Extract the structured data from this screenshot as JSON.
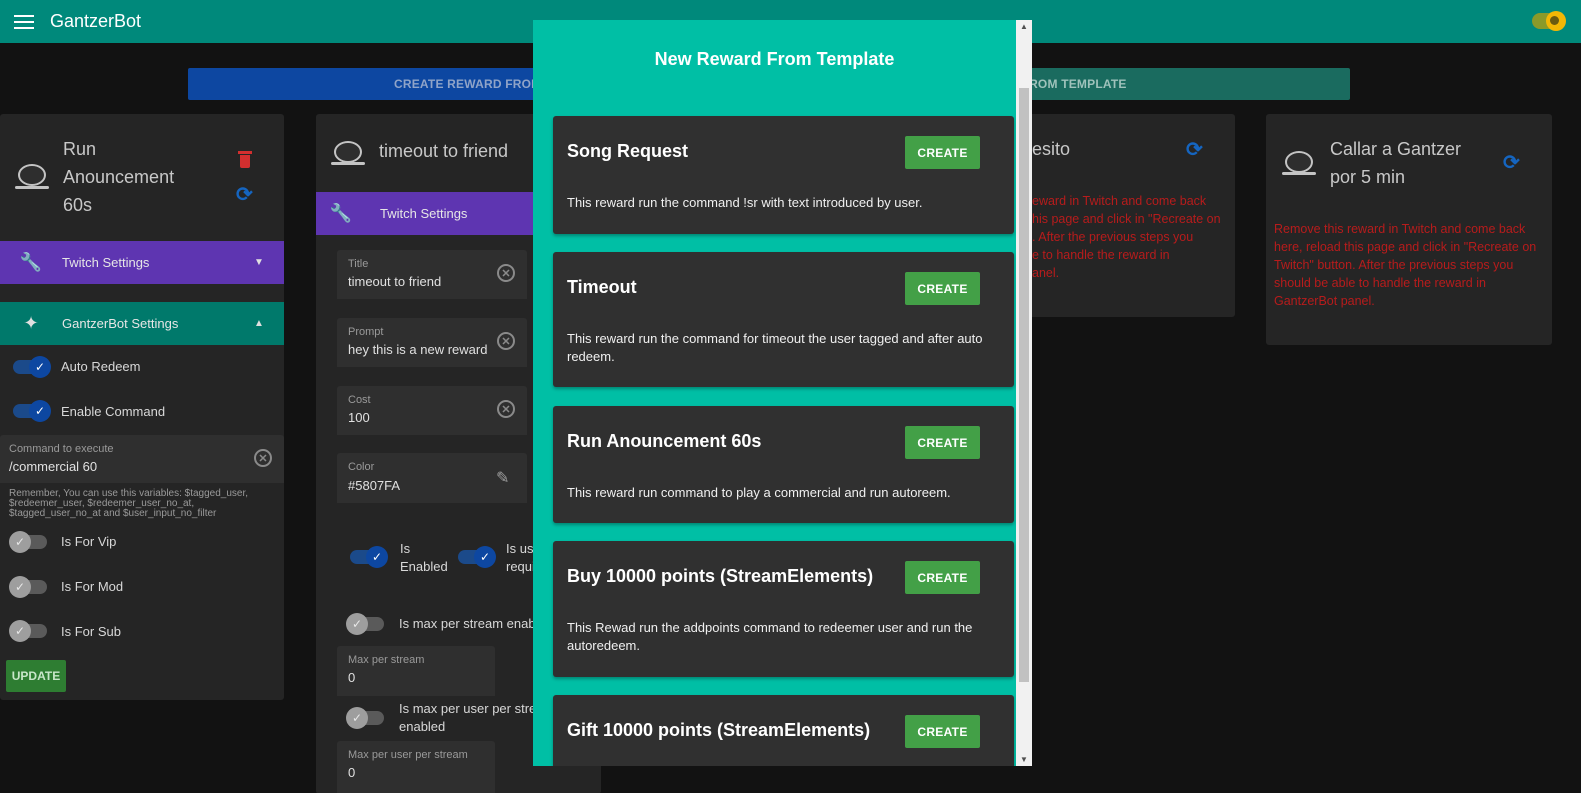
{
  "app": {
    "title": "GantzerBot"
  },
  "top_buttons": {
    "from_scratch": "CREATE REWARD FROM SC",
    "from_template": "ARD FROM TEMPLATE"
  },
  "left_card": {
    "title_lines": [
      "Run",
      "Anouncement",
      "60s"
    ],
    "twitch_settings": "Twitch Settings",
    "gantzer_settings": "GantzerBot Settings",
    "toggles": [
      {
        "label": "Auto Redeem",
        "on": true
      },
      {
        "label": "Enable Command",
        "on": true
      }
    ],
    "command_field": {
      "label": "Command to execute",
      "value": "/commercial 60"
    },
    "hint_lines": [
      "Remember, You can use this variables: $tagged_user,",
      "$redeemer_user, $redeemer_user_no_at,",
      "$tagged_user_no_at and $user_input_no_filter"
    ],
    "role_toggles": [
      {
        "label": "Is For Vip",
        "on": false
      },
      {
        "label": "Is For Mod",
        "on": false
      },
      {
        "label": "Is For Sub",
        "on": false
      }
    ],
    "update_label": "UPDATE"
  },
  "middle_card": {
    "title": "timeout to friend",
    "twitch_settings": "Twitch Settings",
    "fields": {
      "title": {
        "label": "Title",
        "value": "timeout to friend"
      },
      "prompt": {
        "label": "Prompt",
        "value": "hey this is a new reward"
      },
      "cost": {
        "label": "Cost",
        "value": "100"
      },
      "color": {
        "label": "Color",
        "value": "#5807FA"
      },
      "max_per_stream": {
        "label": "Max per stream",
        "value": "0"
      },
      "max_per_user": {
        "label": "Max per user per stream",
        "value": "0"
      }
    },
    "toggles": {
      "is_enabled": [
        "Is",
        "Enabled"
      ],
      "is_user_input": [
        "Is us",
        "requi"
      ],
      "max_per_stream": "Is max per stream enabl",
      "max_per_user": [
        "Is max per user per strea",
        "enabled"
      ]
    }
  },
  "card3": {
    "title": "esito",
    "warn_lines": [
      "eward in Twitch and come back",
      "his page and click in \"Recreate on",
      ". After the previous steps you",
      "e to handle the reward in",
      "anel."
    ]
  },
  "card4": {
    "title_lines": [
      "Callar a Gantzer",
      "por 5 min"
    ],
    "warn_lines": [
      "Remove this reward in Twitch and come back",
      "here, reload this page and click in \"Recreate on",
      "Twitch\" button. After the previous steps you",
      "should be able to handle the reward in",
      "GantzerBot panel."
    ]
  },
  "modal": {
    "title": "New Reward From Template",
    "create_label": "CREATE",
    "templates": [
      {
        "name": "Song Request",
        "desc": [
          "This reward run the command !sr with text introduced by user."
        ]
      },
      {
        "name": "Timeout",
        "desc": [
          "This reward run the command for timeout the user tagged and after auto",
          "redeem."
        ]
      },
      {
        "name": "Run Anouncement 60s",
        "desc": [
          "This reward run command to play a commercial and run autoreem."
        ]
      },
      {
        "name": "Buy 10000 points (StreamElements)",
        "desc": [
          "This Rewad run the addpoints command to redeemer user and run the",
          "autoredeem."
        ]
      },
      {
        "name": "Gift 10000 points (StreamElements)",
        "desc": []
      }
    ]
  },
  "colors": {
    "appbar": "#00897b",
    "modal": "#00bfa5",
    "twitch_section": "#5e35b1",
    "gantzer_section": "#00796b",
    "create_button": "#43a047",
    "warning_text": "#b71c1c"
  },
  "icons": {
    "menu": "menu-icon",
    "theme": "theme-toggle-icon",
    "reward": "gauge-icon",
    "delete": "trash-icon",
    "recreate": "sync-icon",
    "wrench": "wrench-icon",
    "sparkle": "sparkle-icon",
    "clear": "close-circle-icon",
    "eyedropper": "eyedropper-icon"
  }
}
